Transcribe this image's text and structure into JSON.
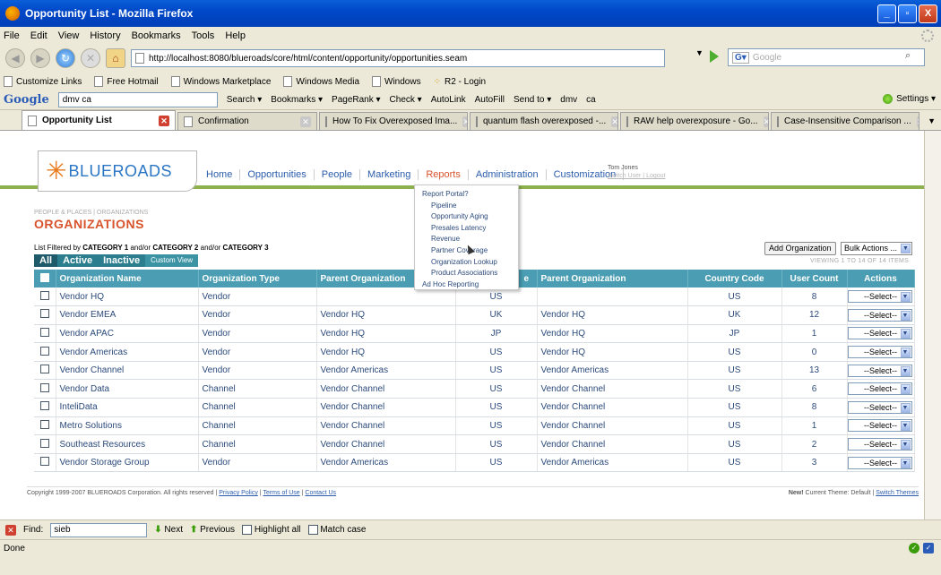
{
  "window": {
    "title": "Opportunity List - Mozilla Firefox",
    "buttons": [
      "_",
      "▫",
      "X"
    ]
  },
  "menu": [
    "File",
    "Edit",
    "View",
    "History",
    "Bookmarks",
    "Tools",
    "Help"
  ],
  "nav": {
    "url": "http://localhost:8080/blueroads/core/html/content/opportunity/opportunities.seam",
    "search_placeholder": "Google"
  },
  "bookmarks": [
    "Customize Links",
    "Free Hotmail",
    "Windows Marketplace",
    "Windows Media",
    "Windows",
    "R2 - Login"
  ],
  "google_toolbar": {
    "logo": "Google",
    "query": "dmv ca",
    "items": [
      "Search ▾",
      "Bookmarks ▾",
      "PageRank ▾",
      "Check ▾",
      "AutoLink",
      "AutoFill",
      "Send to ▾",
      "dmv",
      "ca"
    ],
    "settings": "Settings ▾"
  },
  "tabs": [
    {
      "label": "Opportunity List",
      "active": true
    },
    {
      "label": "Confirmation",
      "active": false
    },
    {
      "label": "How To Fix Overexposed Ima...",
      "active": false
    },
    {
      "label": "quantum flash overexposed -...",
      "active": false
    },
    {
      "label": "RAW help overexposure - Go...",
      "active": false
    },
    {
      "label": "Case-Insensitive Comparison ...",
      "active": false
    }
  ],
  "app": {
    "brand": "BLUEROADS",
    "nav": [
      "Home",
      "Opportunities",
      "People",
      "Marketing",
      "Reports",
      "Administration",
      "Customization"
    ],
    "active_nav": "Reports",
    "user": {
      "name": "Tom Jones",
      "switch": "Switch User",
      "logout": "Logout"
    }
  },
  "breadcrumb": "PEOPLE & PLACES | ORGANIZATIONS",
  "page_title": "ORGANIZATIONS",
  "filter_text": {
    "prefix": "List Filtered by",
    "c1": "CATEGORY 1",
    "mid1": "and/or",
    "c2": "CATEGORY 2",
    "mid2": "and/or",
    "c3": "CATEGORY 3"
  },
  "filter_tabs": [
    "All",
    "Active",
    "Inactive",
    "Custom View"
  ],
  "add_button": "Add Organization",
  "bulk_actions": "Bulk Actions ...",
  "viewing": "VIEWING 1 TO 14 OF 14 ITEMS",
  "columns": [
    "Organization Name",
    "Organization Type",
    "Parent Organization",
    "e",
    "Parent Organization",
    "Country Code",
    "User Count",
    "Actions"
  ],
  "rows": [
    {
      "name": "Vendor HQ",
      "type": "Vendor",
      "parent": "",
      "country": "US",
      "parent2": "",
      "code": "US",
      "count": "8"
    },
    {
      "name": "Vendor EMEA",
      "type": "Vendor",
      "parent": "Vendor HQ",
      "country": "UK",
      "parent2": "Vendor HQ",
      "code": "UK",
      "count": "12"
    },
    {
      "name": "Vendor APAC",
      "type": "Vendor",
      "parent": "Vendor HQ",
      "country": "JP",
      "parent2": "Vendor HQ",
      "code": "JP",
      "count": "1"
    },
    {
      "name": "Vendor Americas",
      "type": "Vendor",
      "parent": "Vendor HQ",
      "country": "US",
      "parent2": "Vendor HQ",
      "code": "US",
      "count": "0"
    },
    {
      "name": "Vendor Channel",
      "type": "Vendor",
      "parent": "Vendor Americas",
      "country": "US",
      "parent2": "Vendor Americas",
      "code": "US",
      "count": "13"
    },
    {
      "name": "Vendor Data",
      "type": "Channel",
      "parent": "Vendor Channel",
      "country": "US",
      "parent2": "Vendor Channel",
      "code": "US",
      "count": "6"
    },
    {
      "name": "InteliData",
      "type": "Channel",
      "parent": "Vendor Channel",
      "country": "US",
      "parent2": "Vendor Channel",
      "code": "US",
      "count": "8"
    },
    {
      "name": "Metro Solutions",
      "type": "Channel",
      "parent": "Vendor Channel",
      "country": "US",
      "parent2": "Vendor Channel",
      "code": "US",
      "count": "1"
    },
    {
      "name": "Southeast Resources",
      "type": "Channel",
      "parent": "Vendor Channel",
      "country": "US",
      "parent2": "Vendor Channel",
      "code": "US",
      "count": "2"
    },
    {
      "name": "Vendor Storage Group",
      "type": "Vendor",
      "parent": "Vendor Americas",
      "country": "US",
      "parent2": "Vendor Americas",
      "code": "US",
      "count": "3"
    }
  ],
  "row_select": "--Select--",
  "reports_menu": [
    {
      "label": "Report Portal?",
      "sub": false
    },
    {
      "label": "Pipeline",
      "sub": true
    },
    {
      "label": "Opportunity Aging",
      "sub": true
    },
    {
      "label": "Presales Latency",
      "sub": true
    },
    {
      "label": "Revenue",
      "sub": true
    },
    {
      "label": "Partner Coverage",
      "sub": true
    },
    {
      "label": "Organization Lookup",
      "sub": true
    },
    {
      "label": "Product Associations",
      "sub": true
    },
    {
      "label": "Ad Hoc Reporting",
      "sub": false
    }
  ],
  "footer": {
    "copyright": "Copyright 1999-2007 BLUEROADS Corporation. All rights reserved |",
    "privacy": "Privacy Policy",
    "terms": "Terms of Use",
    "contact": "Contact Us",
    "new_label": "New!",
    "theme": "Current Theme: Default |",
    "switch": "Switch Themes"
  },
  "findbar": {
    "label": "Find:",
    "value": "sieb",
    "next": "Next",
    "previous": "Previous",
    "highlight": "Highlight all",
    "match": "Match case"
  },
  "status": "Done"
}
